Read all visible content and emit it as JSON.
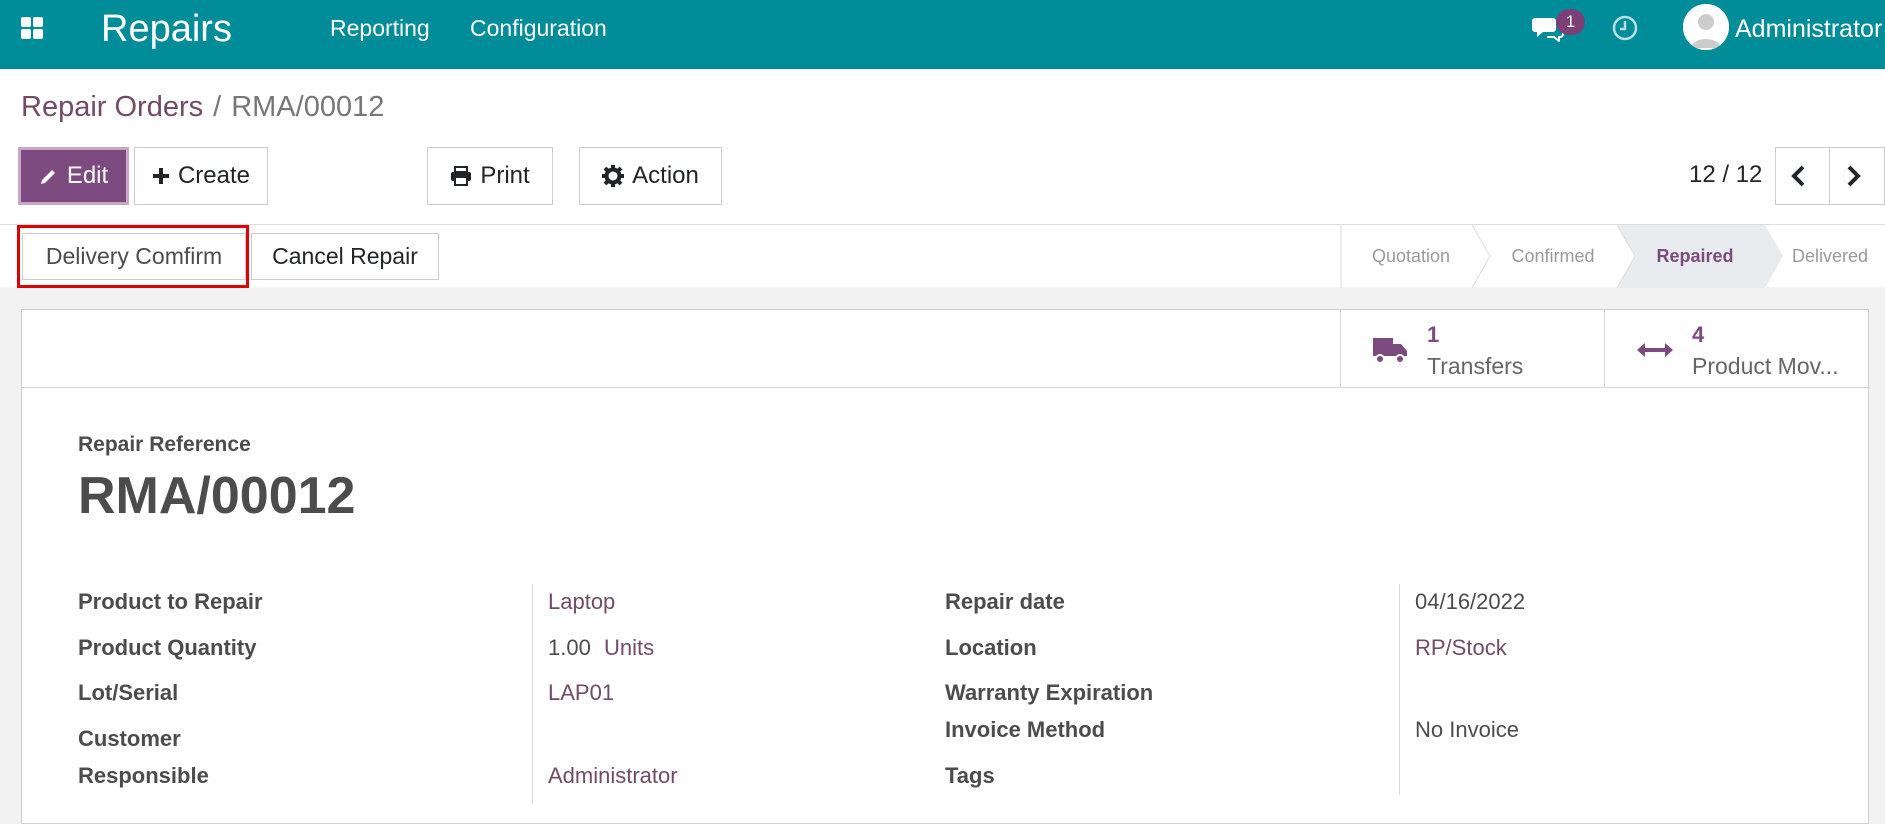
{
  "navbar": {
    "app_name": "Repairs",
    "menus": [
      "Reporting",
      "Configuration"
    ],
    "message_count": "1",
    "user": "Administrator"
  },
  "breadcrumb": {
    "parent": "Repair Orders",
    "separator": "/",
    "current": "RMA/00012"
  },
  "toolbar": {
    "edit_label": "Edit",
    "create_label": "Create",
    "print_label": "Print",
    "action_label": "Action",
    "pager": "12 / 12"
  },
  "statusbar": {
    "buttons": [
      "Delivery Comfirm",
      "Cancel Repair"
    ],
    "stages": [
      "Quotation",
      "Confirmed",
      "Repaired",
      "Delivered"
    ],
    "active_stage": "Repaired"
  },
  "smart_buttons": [
    {
      "count": "1",
      "label": "Transfers",
      "icon": "truck-icon"
    },
    {
      "count": "4",
      "label": "Product Mov...",
      "icon": "arrows-horizontal-icon"
    }
  ],
  "form": {
    "title_label": "Repair Reference",
    "title": "RMA/00012",
    "left": {
      "product_label": "Product to Repair",
      "product_value": "Laptop",
      "qty_label": "Product Quantity",
      "qty_value": "1.00",
      "qty_uom": "Units",
      "lot_label": "Lot/Serial",
      "lot_value": "LAP01",
      "customer_label": "Customer",
      "responsible_label": "Responsible",
      "responsible_value": "Administrator"
    },
    "right": {
      "date_label": "Repair date",
      "date_value": "04/16/2022",
      "location_label": "Location",
      "location_value": "RP/Stock",
      "warranty_label": "Warranty Expiration",
      "invoice_label": "Invoice Method",
      "invoice_value": "No Invoice",
      "tags_label": "Tags"
    }
  },
  "colors": {
    "navbar": "#008c99",
    "brand_purple": "#714b67",
    "highlight_red": "#e00000"
  }
}
